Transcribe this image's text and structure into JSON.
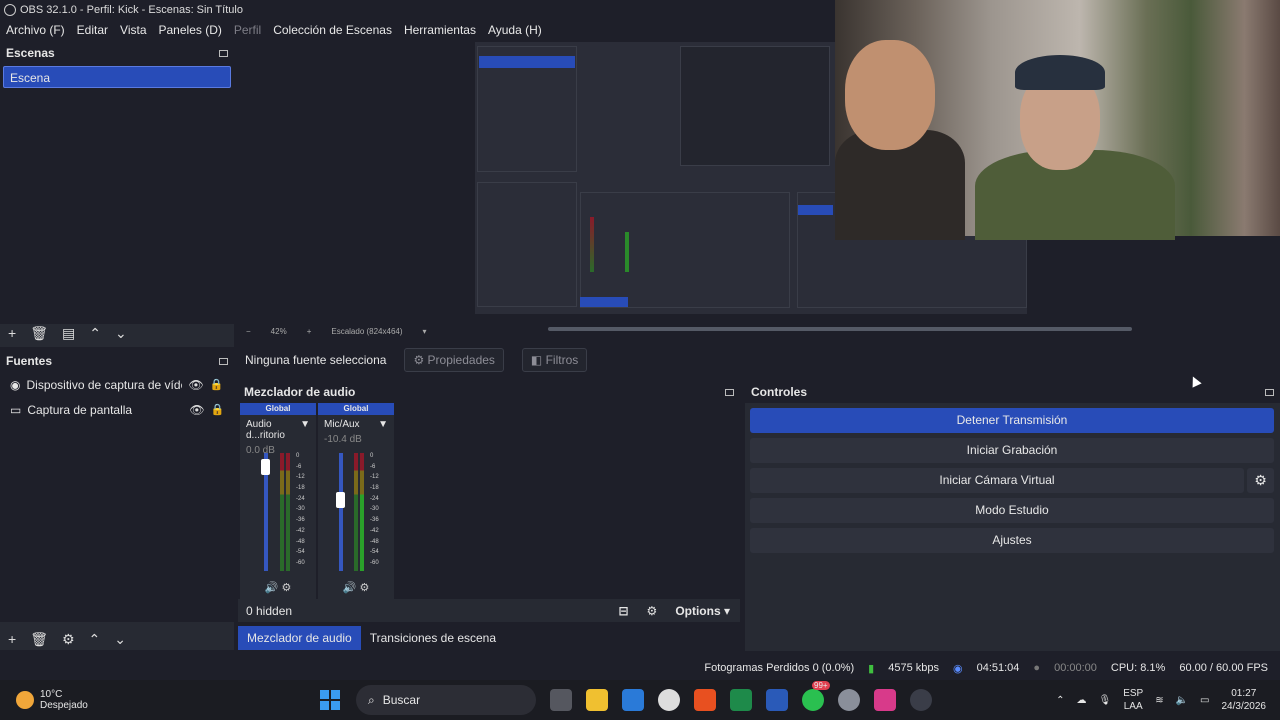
{
  "title": "OBS 32.1.0 - Perfil: Kick - Escenas: Sin Título",
  "menu": [
    {
      "label": "Archivo (F)",
      "dim": false
    },
    {
      "label": "Editar",
      "dim": false
    },
    {
      "label": "Vista",
      "dim": false
    },
    {
      "label": "Paneles (D)",
      "dim": false
    },
    {
      "label": "Perfil",
      "dim": true
    },
    {
      "label": "Colección de Escenas",
      "dim": false
    },
    {
      "label": "Herramientas",
      "dim": false
    },
    {
      "label": "Ayuda (H)",
      "dim": false
    }
  ],
  "scenes": {
    "title": "Escenas",
    "items": [
      "Escena"
    ]
  },
  "preview": {
    "zoom": "42%",
    "scale": "Escalado (824x464)"
  },
  "source_bar": {
    "selection": "Ninguna fuente selecciona",
    "properties": "Propiedades",
    "filters": "Filtros"
  },
  "sources": {
    "title": "Fuentes",
    "items": [
      {
        "name": "Dispositivo de captura de vídeo",
        "icon": "camera-icon"
      },
      {
        "name": "Captura de pantalla",
        "icon": "monitor-icon"
      }
    ]
  },
  "mixer": {
    "title": "Mezclador de audio",
    "channels": [
      {
        "head": "Global",
        "name": "Audio d...ritorio",
        "db": "0.0 dB",
        "level": 0.94
      },
      {
        "head": "Global",
        "name": "Mic/Aux",
        "db": "-10.4 dB",
        "level": 0.62
      }
    ],
    "scale": [
      "0",
      "-6",
      "-12",
      "-18",
      "-24",
      "-30",
      "-36",
      "-42",
      "-48",
      "-54",
      "-60"
    ],
    "hidden": "0 hidden",
    "options": "Options"
  },
  "tabs": [
    "Mezclador de audio",
    "Transiciones de escena"
  ],
  "controls": {
    "title": "Controles",
    "buttons": [
      "Detener Transmisión",
      "Iniciar Grabación",
      "Iniciar Cámara Virtual",
      "Modo Estudio",
      "Ajustes"
    ]
  },
  "status": {
    "dropped": "Fotogramas Perdidos 0 (0.0%)",
    "bitrate": "4575 kbps",
    "stream_time": "04:51:04",
    "rec_time": "00:00:00",
    "cpu": "CPU: 8.1%",
    "fps": "60.00 / 60.00 FPS"
  },
  "taskbar": {
    "temp": "10°C",
    "weather": "Despejado",
    "search": "Buscar",
    "badge": "99+",
    "lang1": "ESP",
    "lang2": "LAA",
    "time": "01:27",
    "date": "24/3/2026"
  }
}
